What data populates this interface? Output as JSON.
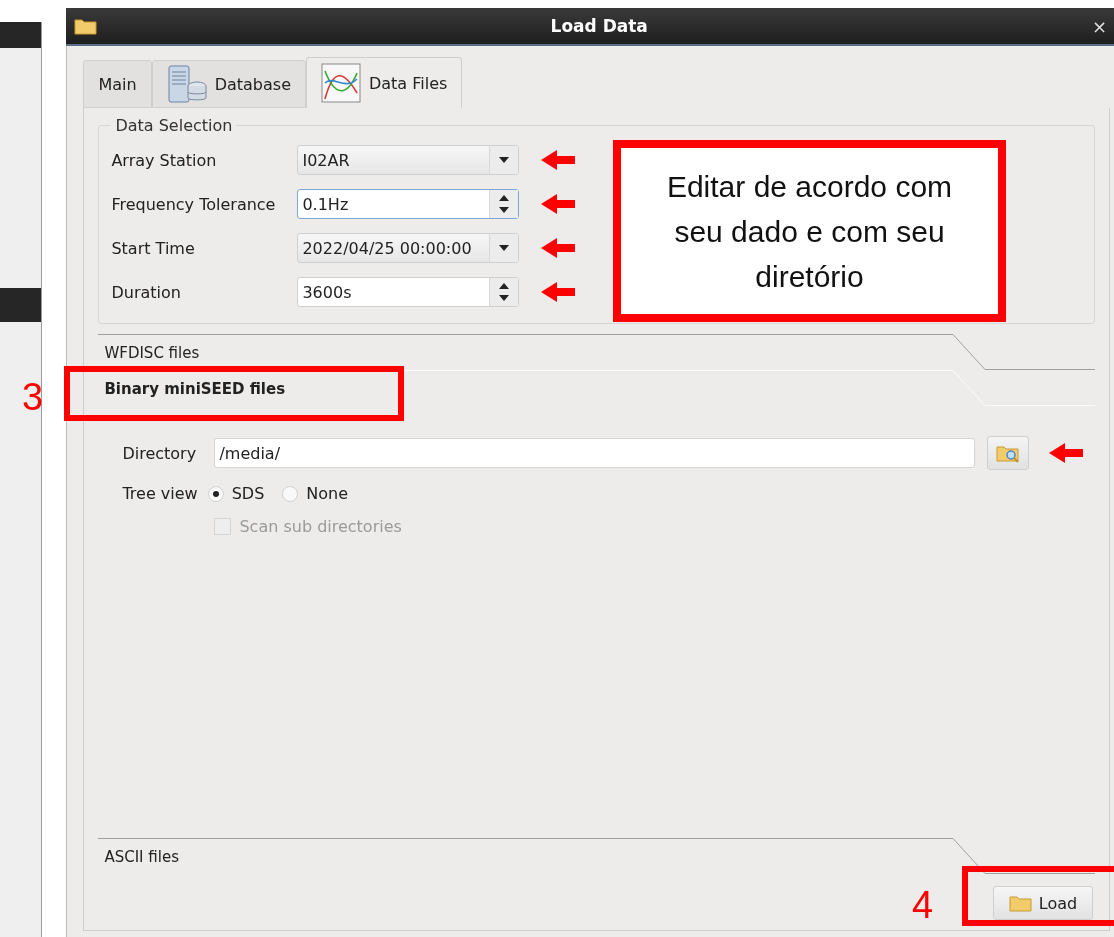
{
  "window": {
    "title": "Load Data",
    "close": "×"
  },
  "tabs": [
    {
      "label": "Main",
      "kind": "plain",
      "selected": false
    },
    {
      "label": "Database",
      "kind": "database",
      "selected": false
    },
    {
      "label": "Data Files",
      "kind": "chart",
      "selected": true
    }
  ],
  "data_selection": {
    "title": "Data Selection",
    "fields": [
      {
        "kind": "combo",
        "label": "Array Station",
        "value": "I02AR",
        "focused": false,
        "marked": true
      },
      {
        "kind": "spin",
        "label": "Frequency Tolerance",
        "value": "0.1Hz",
        "focused": true,
        "marked": true
      },
      {
        "kind": "combo",
        "label": "Start Time",
        "value": "2022/04/25 00:00:00",
        "focused": false,
        "marked": true
      },
      {
        "kind": "spin",
        "label": "Duration",
        "value": "3600s",
        "focused": false,
        "marked": true
      }
    ]
  },
  "sections": [
    {
      "title": "WFDISC files",
      "expanded": false
    },
    {
      "title": "Binary miniSEED files",
      "expanded": true
    },
    {
      "title": "ASCII files",
      "expanded": false
    }
  ],
  "directory": {
    "label": "Directory",
    "value": "/media/",
    "marked": true
  },
  "tree_view": {
    "label": "Tree view",
    "options": [
      {
        "label": "SDS",
        "selected": true
      },
      {
        "label": "None",
        "selected": false
      }
    ]
  },
  "scan": {
    "label": "Scan sub directories",
    "checked": false,
    "disabled": true
  },
  "load_button": {
    "label": "Load"
  },
  "annotations": {
    "note": "Editar de acordo com seu dado e com seu diretório",
    "markers": [
      {
        "label": "3"
      },
      {
        "label": "4"
      }
    ]
  }
}
